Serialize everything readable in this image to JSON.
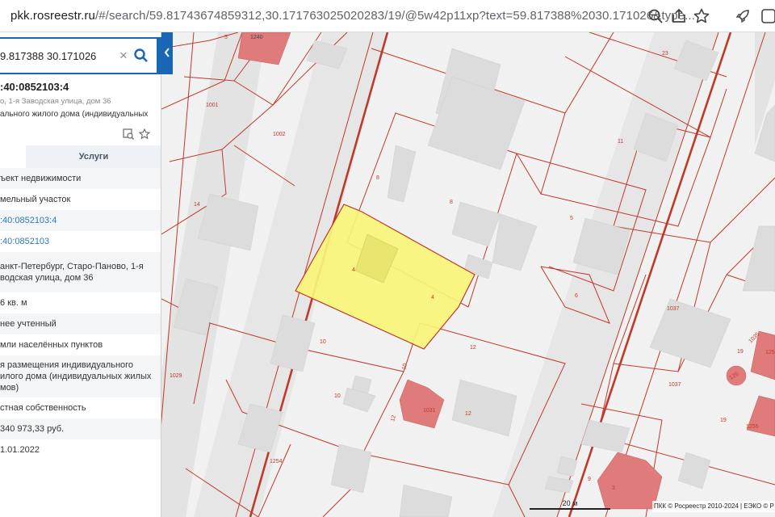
{
  "browser": {
    "url_domain": "pkk.rosreestr.ru",
    "url_path": "/#/search/59.81743674859312,30.171763025020283/19/@5w42p11xp?text=59.817388%2030.171026&type..."
  },
  "search": {
    "value": "9.817388 30.171026",
    "clear_icon": "×"
  },
  "object": {
    "number": ":40:0852103:4",
    "address": "о, 1-я Заводская улица, дом 36",
    "purpose": "ального жилого дома (индивидуальных"
  },
  "tabs": {
    "services": "Услуги"
  },
  "attributes": [
    {
      "lines": [
        "ъект недвижимости"
      ],
      "link": false
    },
    {
      "lines": [
        "мельный участок"
      ],
      "link": false
    },
    {
      "lines": [
        ":40:0852103:4"
      ],
      "link": true
    },
    {
      "lines": [
        ":40:0852103"
      ],
      "link": true
    },
    {
      "lines": [
        "анкт-Петербург, Старо-Паново, 1-я",
        "водская улица, дом 36"
      ],
      "link": false
    },
    {
      "lines": [
        "6 кв. м"
      ],
      "link": false
    },
    {
      "lines": [
        "нее учтенный"
      ],
      "link": false
    },
    {
      "lines": [
        "мли населённых пунктов"
      ],
      "link": false
    },
    {
      "lines": [
        "я размещения индивидуального",
        "илого дома (индивидуальных жилых",
        "мов)"
      ],
      "link": false
    },
    {
      "lines": [
        "стная собственность"
      ],
      "link": false
    },
    {
      "lines": [
        "340 973,33 руб."
      ],
      "link": false
    },
    {
      "lines": [
        "1.01.2022"
      ],
      "link": false
    }
  ],
  "map": {
    "scale_label": "20 м",
    "copyright": "ПКК © Росреестр 2010-2024 | ЕЭКО © Р",
    "labels": [
      {
        "t": "5",
        "cls": "lbl"
      },
      {
        "t": "1240",
        "cls": "lbl-w"
      },
      {
        "t": "23",
        "cls": "lbl"
      },
      {
        "t": "1001",
        "cls": "lbl"
      },
      {
        "t": "1002",
        "cls": "lbl"
      },
      {
        "t": "11",
        "cls": "lbl"
      },
      {
        "t": "8",
        "cls": "lbl"
      },
      {
        "t": "8",
        "cls": "lbl"
      },
      {
        "t": "14",
        "cls": "lbl"
      },
      {
        "t": "5",
        "cls": "lbl"
      },
      {
        "t": "4",
        "cls": "lbl"
      },
      {
        "t": "4",
        "cls": "lbl"
      },
      {
        "t": "6",
        "cls": "lbl"
      },
      {
        "t": "1037",
        "cls": "lbl"
      },
      {
        "t": "10",
        "cls": "lbl"
      },
      {
        "t": "12",
        "cls": "lbl"
      },
      {
        "t": "10",
        "cls": "lbl"
      },
      {
        "t": "1029",
        "cls": "lbl"
      },
      {
        "t": "10",
        "cls": "lbl"
      },
      {
        "t": "1031",
        "cls": "lbl-w"
      },
      {
        "t": "12",
        "cls": "lbl"
      },
      {
        "t": "12",
        "cls": "lbl"
      },
      {
        "t": "1037",
        "cls": "lbl"
      },
      {
        "t": "19",
        "cls": "lbl"
      },
      {
        "t": "19",
        "cls": "lbl-w"
      },
      {
        "t": "1255",
        "cls": "lbl-w"
      },
      {
        "t": "1254",
        "cls": "lbl-w"
      },
      {
        "t": "9",
        "cls": "lbl"
      },
      {
        "t": "3",
        "cls": "lbl"
      },
      {
        "t": "1035",
        "cls": "lbl-w"
      },
      {
        "t": "125",
        "cls": "lbl-w"
      },
      {
        "t": "125",
        "cls": "lbl-w"
      }
    ]
  },
  "colors": {
    "accent": "#1966b4",
    "parcel_line": "#c0392b",
    "selected_parcel": "#f8f57a",
    "building": "#dcdcdc",
    "building_red": "#e07b7b"
  },
  "icons": {
    "search": "magnifier-icon",
    "zoom": "zoom-out-icon",
    "share": "share-icon",
    "favorite": "star-icon",
    "extensions": "rocket-icon",
    "profile": "profile-icon",
    "menu": "kebab-menu-icon"
  }
}
